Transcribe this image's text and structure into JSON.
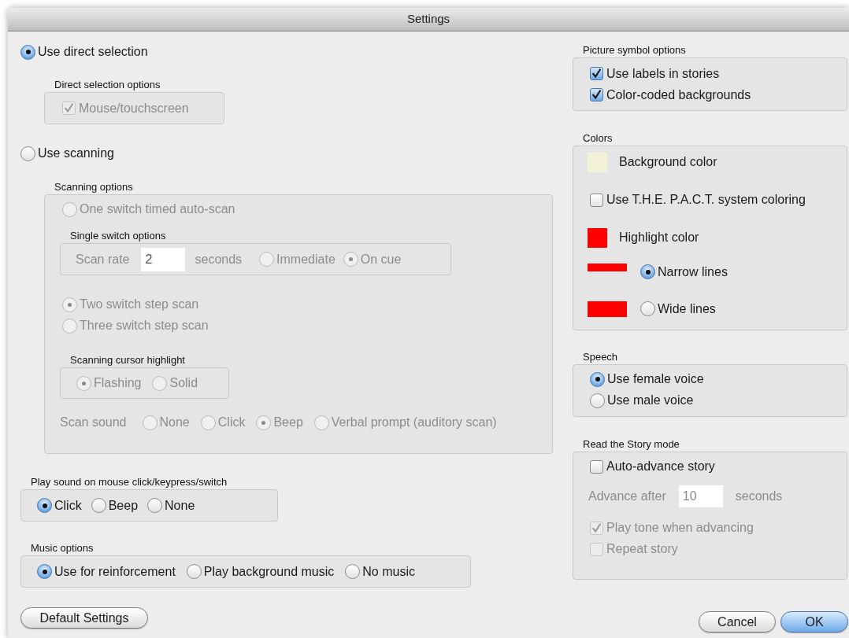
{
  "window": {
    "title": "Settings"
  },
  "direct_selection": {
    "label": "Use direct selection",
    "selected": true,
    "group": {
      "title": "Direct selection options",
      "checkbox": {
        "label": "Mouse/touchscreen",
        "checked": true,
        "disabled": true
      }
    }
  },
  "scanning": {
    "label": "Use scanning",
    "selected": false,
    "group": {
      "title": "Scanning options",
      "disabled": true,
      "auto_scan": {
        "label": "One switch timed auto-scan",
        "selected": false
      },
      "single_switch": {
        "title": "Single switch options",
        "rate_label": "Scan rate",
        "rate_value": "2",
        "unit": "seconds",
        "modes": [
          {
            "label": "Immediate",
            "selected": false
          },
          {
            "label": "On cue",
            "selected": true
          }
        ]
      },
      "step_scan": [
        {
          "label": "Two switch step scan",
          "selected": true
        },
        {
          "label": "Three switch step scan",
          "selected": false
        }
      ],
      "cursor_highlight": {
        "title": "Scanning cursor highlight",
        "options": [
          {
            "label": "Flashing",
            "selected": true
          },
          {
            "label": "Solid",
            "selected": false
          }
        ]
      },
      "scan_sound": {
        "label": "Scan sound",
        "options": [
          {
            "label": "None",
            "selected": false
          },
          {
            "label": "Click",
            "selected": false
          },
          {
            "label": "Beep",
            "selected": true
          },
          {
            "label": "Verbal prompt (auditory scan)",
            "selected": false
          }
        ]
      }
    }
  },
  "click_sound": {
    "title": "Play sound on mouse click/keypress/switch",
    "options": [
      {
        "label": "Click",
        "selected": true
      },
      {
        "label": "Beep",
        "selected": false
      },
      {
        "label": "None",
        "selected": false
      }
    ]
  },
  "music": {
    "title": "Music options",
    "options": [
      {
        "label": "Use for reinforcement",
        "selected": true
      },
      {
        "label": "Play background music",
        "selected": false
      },
      {
        "label": "No music",
        "selected": false
      }
    ]
  },
  "default_button": "Default Settings",
  "picture_symbols": {
    "title": "Picture symbol options",
    "options": [
      {
        "label": "Use labels in stories",
        "checked": true
      },
      {
        "label": "Color-coded backgrounds",
        "checked": true
      }
    ]
  },
  "colors": {
    "title": "Colors",
    "rows": [
      {
        "kind": "swatch",
        "label": "Background color",
        "color": "#f3f1d8"
      },
      {
        "kind": "checkbox",
        "label": "Use T.H.E. P.A.C.T. system coloring",
        "checked": false
      },
      {
        "kind": "swatch",
        "label": "Highlight color",
        "color": "#ff0000"
      },
      {
        "kind": "narrow_line",
        "label": "Narrow lines",
        "selected": true,
        "color": "#ff0000"
      },
      {
        "kind": "wide_line",
        "label": "Wide lines",
        "selected": false,
        "color": "#ff0000"
      }
    ]
  },
  "speech": {
    "title": "Speech",
    "options": [
      {
        "label": "Use female voice",
        "selected": true
      },
      {
        "label": "Use male voice",
        "selected": false
      }
    ]
  },
  "read_story": {
    "title": "Read the Story mode",
    "auto_advance": {
      "label": "Auto-advance story",
      "checked": false
    },
    "advance_label": "Advance after",
    "advance_value": "10",
    "unit": "seconds",
    "disabled": true,
    "options": [
      {
        "label": "Play tone when advancing",
        "checked": true
      },
      {
        "label": "Repeat story",
        "checked": false
      }
    ]
  },
  "buttons": [
    {
      "label": "Cancel",
      "default": false
    },
    {
      "label": "OK",
      "default": true
    }
  ]
}
